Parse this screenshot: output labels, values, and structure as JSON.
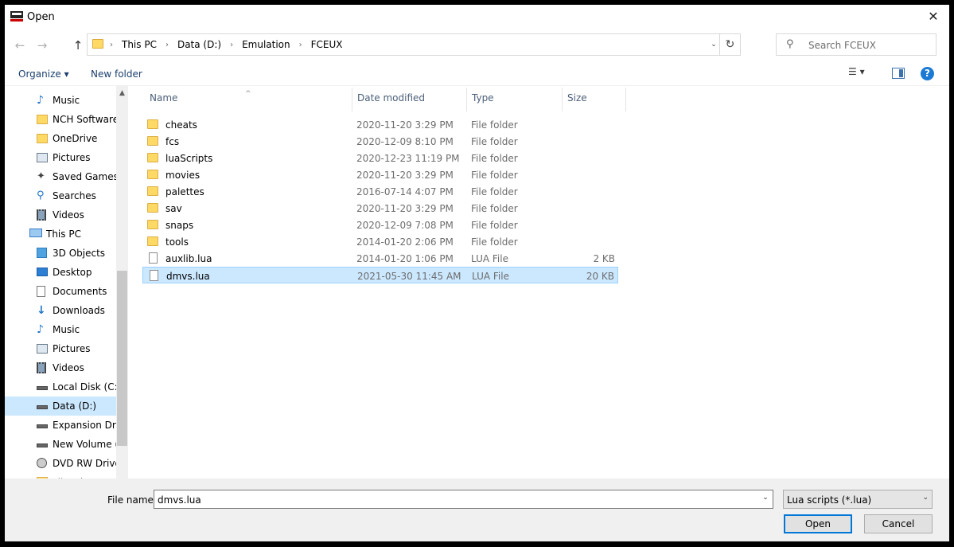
{
  "window": {
    "title": "Open",
    "close_glyph": "✕",
    "app_icon": "fceux-app-icon"
  },
  "nav_buttons": {
    "back": "←",
    "forward": "→",
    "up": "↑"
  },
  "address": {
    "crumbs": [
      "This PC",
      "Data (D:)",
      "Emulation",
      "FCEUX"
    ],
    "separator": "›",
    "dropdown_glyph": "⌄",
    "refresh_glyph": "↻"
  },
  "search": {
    "placeholder": "Search FCEUX",
    "icon_glyph": "⚲"
  },
  "toolbar": {
    "organize": "Organize ▾",
    "new_folder": "New folder",
    "view_glyph": "☰ ▾",
    "help_glyph": "?"
  },
  "nav_pane": {
    "items": [
      {
        "label": "Music",
        "icon": "music-icon"
      },
      {
        "label": "NCH Software",
        "icon": "folder-icon"
      },
      {
        "label": "OneDrive",
        "icon": "folder-icon"
      },
      {
        "label": "Pictures",
        "icon": "pictures-icon"
      },
      {
        "label": "Saved Games",
        "icon": "saved-games-icon"
      },
      {
        "label": "Searches",
        "icon": "search-icon"
      },
      {
        "label": "Videos",
        "icon": "videos-icon"
      },
      {
        "label": "This PC",
        "icon": "computer-icon"
      },
      {
        "label": "3D Objects",
        "icon": "3d-objects-icon"
      },
      {
        "label": "Desktop",
        "icon": "desktop-icon"
      },
      {
        "label": "Documents",
        "icon": "documents-icon"
      },
      {
        "label": "Downloads",
        "icon": "downloads-icon"
      },
      {
        "label": "Music",
        "icon": "music-icon"
      },
      {
        "label": "Pictures",
        "icon": "pictures-icon"
      },
      {
        "label": "Videos",
        "icon": "videos-icon"
      },
      {
        "label": "Local Disk (C:)",
        "icon": "drive-icon"
      },
      {
        "label": "Data (D:)",
        "icon": "drive-icon"
      },
      {
        "label": "Expansion Drive",
        "icon": "drive-icon"
      },
      {
        "label": "New Volume (F",
        "icon": "drive-icon"
      },
      {
        "label": "DVD RW Drive",
        "icon": "dvd-drive-icon"
      },
      {
        "label": "Libraries",
        "icon": "libraries-icon"
      }
    ],
    "selected_label": "Data (D:)",
    "scroll_up_glyph": "▲"
  },
  "columns": {
    "name": "Name",
    "date": "Date modified",
    "type": "Type",
    "size": "Size",
    "sort_glyph": "^"
  },
  "files": [
    {
      "name": "cheats",
      "date": "2020-11-20 3:29 PM",
      "type": "File folder",
      "size": "",
      "kind": "folder"
    },
    {
      "name": "fcs",
      "date": "2020-12-09 8:10 PM",
      "type": "File folder",
      "size": "",
      "kind": "folder"
    },
    {
      "name": "luaScripts",
      "date": "2020-12-23 11:19 PM",
      "type": "File folder",
      "size": "",
      "kind": "folder"
    },
    {
      "name": "movies",
      "date": "2020-11-20 3:29 PM",
      "type": "File folder",
      "size": "",
      "kind": "folder"
    },
    {
      "name": "palettes",
      "date": "2016-07-14 4:07 PM",
      "type": "File folder",
      "size": "",
      "kind": "folder"
    },
    {
      "name": "sav",
      "date": "2020-11-20 3:29 PM",
      "type": "File folder",
      "size": "",
      "kind": "folder"
    },
    {
      "name": "snaps",
      "date": "2020-12-09 7:08 PM",
      "type": "File folder",
      "size": "",
      "kind": "folder"
    },
    {
      "name": "tools",
      "date": "2014-01-20 2:06 PM",
      "type": "File folder",
      "size": "",
      "kind": "folder"
    },
    {
      "name": "auxlib.lua",
      "date": "2014-01-20 1:06 PM",
      "type": "LUA File",
      "size": "2 KB",
      "kind": "file"
    },
    {
      "name": "dmvs.lua",
      "date": "2021-05-30 11:45 AM",
      "type": "LUA File",
      "size": "20 KB",
      "kind": "file"
    }
  ],
  "selected_file": "dmvs.lua",
  "footer": {
    "file_name_label": "File name:",
    "file_name_value": "dmvs.lua",
    "filter_value": "Lua scripts (*.lua)",
    "dropdown_glyph": "⌄",
    "open_label": "Open",
    "cancel_label": "Cancel"
  },
  "colors": {
    "selection": "#cce8ff",
    "folder": "#ffd966",
    "accent": "#0078d7"
  }
}
